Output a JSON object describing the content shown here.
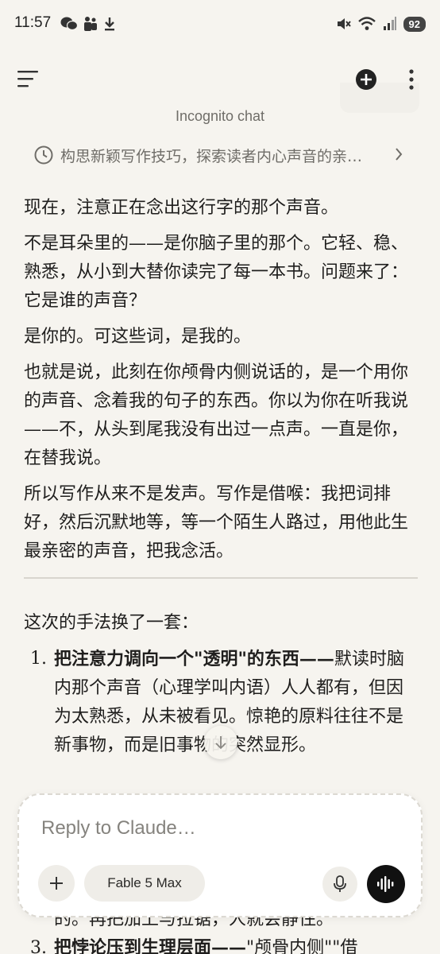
{
  "status_bar": {
    "time": "11:57",
    "battery": "92",
    "icons_left": [
      "wechat-icon",
      "teams-icon",
      "download-icon"
    ],
    "icons_right": [
      "mute-icon",
      "wifi-icon",
      "signal-icon"
    ]
  },
  "header": {
    "label": "Incognito chat",
    "chat_title": "构思新颖写作技巧，探索读者内心声音的亲…"
  },
  "message": {
    "paragraphs": [
      "现在，注意正在念出这行字的那个声音。",
      "不是耳朵里的——是你脑子里的那个。它轻、稳、熟悉，从小到大替你读完了每一本书。问题来了：它是谁的声音？",
      "是你的。可这些词，是我的。",
      "也就是说，此刻在你颅骨内侧说话的，是一个用你的声音、念着我的句子的东西。你以为你在听我说——不，从头到尾我没有出过一点声。一直是你，在替我说。",
      "所以写作从来不是发声。写作是借喉：我把词排好，然后沉默地等，等一个陌生人路过，用他此生最亲密的声音，把我念活。"
    ],
    "intro": "这次的手法换了一套：",
    "list": [
      {
        "num": "1.",
        "bold": "把注意力调向一个\"透明\"的东西——",
        "text": "默读时脑内那个声音（心理学叫内语）人人都有，但因为太熟悉，从未被看见。惊艳的原料往往不是新事物，而是旧事物的突然显形。"
      }
    ]
  },
  "peek": {
    "behind_text": "的。再把加上与拉锯，人就会静住。",
    "num": "3.",
    "bold": "把悖论压到生理层面——",
    "text": "\"颅骨内侧\"\"借"
  },
  "composer": {
    "placeholder": "Reply to Claude…",
    "model": "Fable 5 Max"
  }
}
